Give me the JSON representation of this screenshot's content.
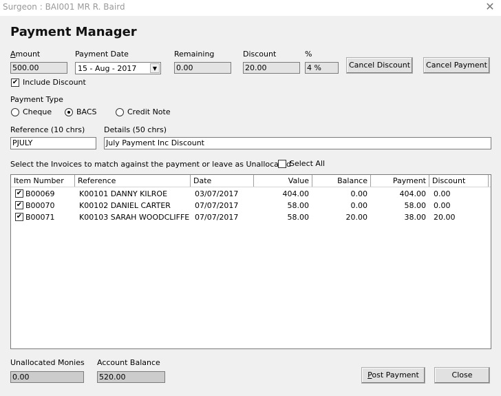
{
  "window": {
    "title": "Surgeon : BAI001 MR R. Baird",
    "close_icon": "✕"
  },
  "heading": "Payment Manager",
  "fields": {
    "amount_label": "Amount",
    "amount_value": "500.00",
    "payment_date_label": "Payment Date",
    "payment_date_value": "15 - Aug - 2017",
    "remaining_label": "Remaining",
    "remaining_value": "0.00",
    "discount_label": "Discount",
    "discount_value": "20.00",
    "percent_label": "%",
    "percent_value": "4 %",
    "include_discount_label": "Include Discount",
    "include_discount_checked": true
  },
  "buttons": {
    "cancel_discount": "Cancel Discount",
    "cancel_payment": "Cancel Payment",
    "post_payment": "Post Payment",
    "close": "Close"
  },
  "payment_type": {
    "label": "Payment Type",
    "options": [
      "Cheque",
      "BACS",
      "Credit Note"
    ],
    "selected": "BACS"
  },
  "reference": {
    "label": "Reference (10 chrs)",
    "value": "PJULY"
  },
  "details": {
    "label": "Details (50 chrs)",
    "value": "July Payment Inc Discount"
  },
  "invoices": {
    "instruction": "Select the Invoices to match against the payment or leave as Unallocated",
    "select_all_label": "Select All",
    "select_all_checked": false,
    "columns": [
      "Item Number",
      "Reference",
      "Date",
      "Value",
      "Balance",
      "Payment",
      "Discount"
    ],
    "rows": [
      {
        "checked": true,
        "item": "B00069",
        "reference": "K00101 DANNY KILROE",
        "date": "03/07/2017",
        "value": "404.00",
        "balance": "0.00",
        "payment": "404.00",
        "discount": "0.00"
      },
      {
        "checked": true,
        "item": "B00070",
        "reference": "K00102 DANIEL CARTER",
        "date": "07/07/2017",
        "value": "58.00",
        "balance": "0.00",
        "payment": "58.00",
        "discount": "0.00"
      },
      {
        "checked": true,
        "item": "B00071",
        "reference": "K00103 SARAH WOODCLIFFE",
        "date": "07/07/2017",
        "value": "58.00",
        "balance": "20.00",
        "payment": "38.00",
        "discount": "20.00"
      }
    ]
  },
  "footer": {
    "unallocated_label": "Unallocated Monies",
    "unallocated_value": "0.00",
    "account_balance_label": "Account Balance",
    "account_balance_value": "520.00"
  },
  "icons": {
    "check": "✔",
    "dropdown": "▼"
  }
}
